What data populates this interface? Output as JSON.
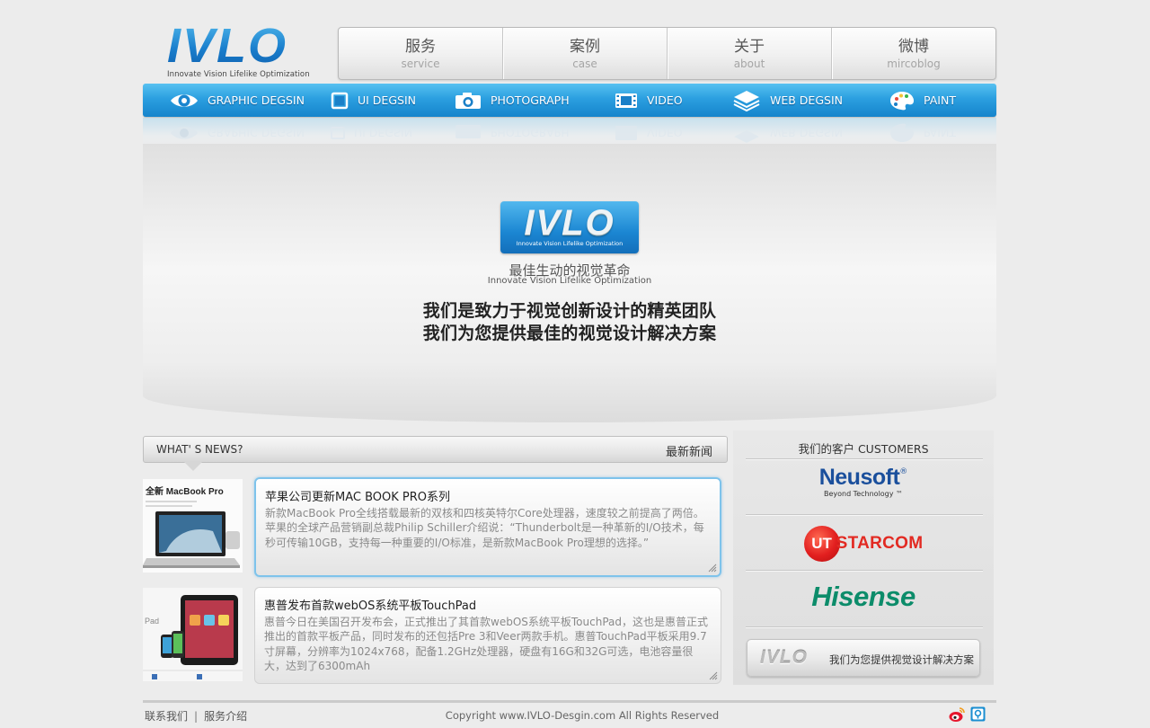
{
  "brand": {
    "logo_text": "IVLO",
    "tagline": "Innovate Vision Lifelike Optimization"
  },
  "nav": [
    {
      "cn": "服务",
      "en": "service"
    },
    {
      "cn": "案例",
      "en": "case"
    },
    {
      "cn": "关于",
      "en": "about"
    },
    {
      "cn": "微博",
      "en": "mircoblog"
    }
  ],
  "categories": [
    {
      "label": "GRAPHIC DEGSIN",
      "icon": "eye-icon"
    },
    {
      "label": "UI DEGSIN",
      "icon": "square-icon"
    },
    {
      "label": "PHOTOGRAPH",
      "icon": "camera-icon"
    },
    {
      "label": "VIDEO",
      "icon": "film-icon"
    },
    {
      "label": "WEB DEGSIN",
      "icon": "layers-icon"
    },
    {
      "label": "PAINT",
      "icon": "palette-icon"
    }
  ],
  "hero": {
    "badge_text": "IVLO",
    "badge_tagline": "Innovate Vision Lifelike Optimization",
    "slogan_cn": "最佳生动的视觉革命",
    "slogan_en": "Innovate Vision Lifelike Optimization",
    "line1": "我们是致力于视觉创新设计的精英团队",
    "line2": "我们为您提供最佳的视觉设计解决方案"
  },
  "news": {
    "header_left": "WHAT' S NEWS?",
    "header_right": "最新新闻",
    "items": [
      {
        "thumb_label": "全新 MacBook Pro",
        "title": "苹果公司更新MAC BOOK PRO系列",
        "body": "新款MacBook Pro全线搭载最新的双核和四核英特尔Core处理器，速度较之前提高了两倍。苹果的全球产品营销副总裁Philip Schiller介绍说：“Thunderbolt是一种革新的I/O技术，每秒可传输10GB，支持每一种重要的I/O标准，是新款MacBook Pro理想的选择。”"
      },
      {
        "thumb_label": "Pad",
        "title": "惠普发布首款webOS系统平板TouchPad",
        "body": "惠普今日在美国召开发布会，正式推出了其首款webOS系统平板TouchPad，这也是惠普正式推出的首款平板产品，同时发布的还包括Pre 3和Veer两款手机。惠普TouchPad平板采用9.7寸屏幕，分辨率为1024x768，配备1.2GHz处理器，硬盘有16G和32G可选，电池容量很大，达到了6300mAh"
      }
    ]
  },
  "customers": {
    "title": "我们的客户   CUSTOMERS",
    "neusoft": {
      "name": "Neusoft",
      "sub": "Beyond Technology ™",
      "reg": "®"
    },
    "utstarcom": {
      "ut": "UT",
      "rest": "STARCOM"
    },
    "hisense": {
      "name": "Hisense"
    },
    "banner_logo": "IVLO",
    "banner_text": "我们为您提供视觉设计解决方案"
  },
  "footer": {
    "links": [
      "联系我们",
      "服务介绍"
    ],
    "separator": "|",
    "copyright": "Copyright www.IVLO-Desgin.com All Rights Reserved"
  }
}
